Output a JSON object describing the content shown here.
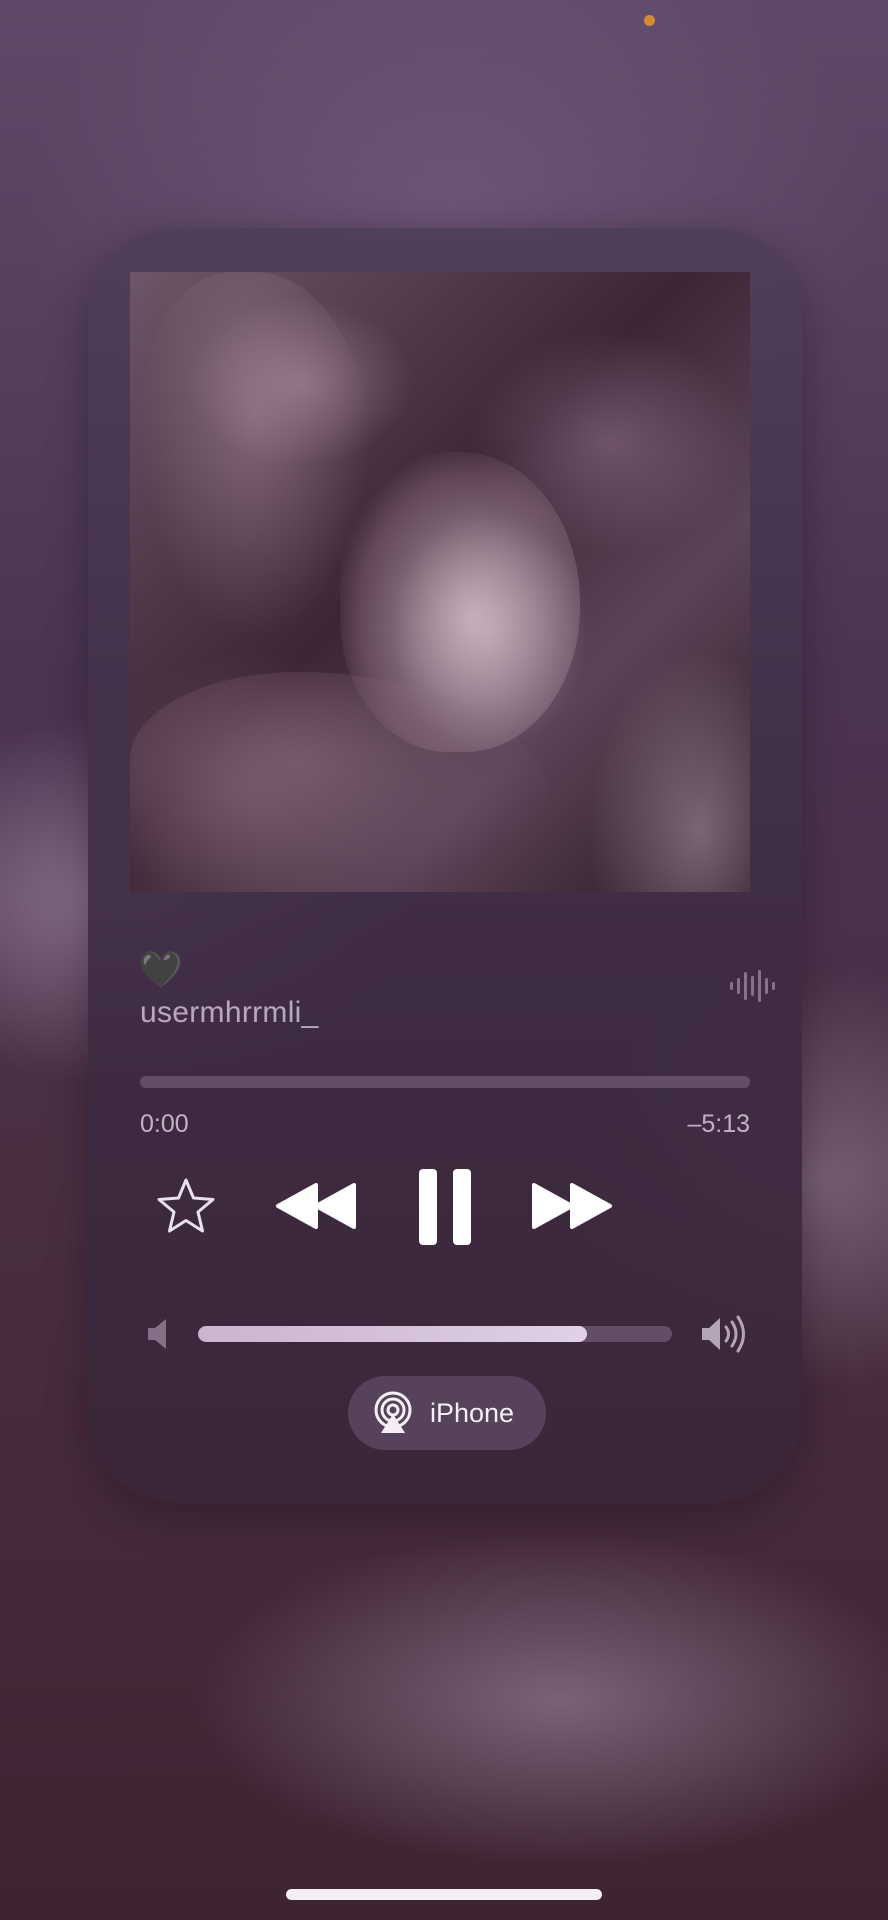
{
  "player": {
    "favorite_emoji": "🖤",
    "title": "usermhrrmli_",
    "progress": {
      "elapsed": "0:00",
      "remaining": "–5:13",
      "fraction": 0.0
    },
    "volume": {
      "level": 0.82
    },
    "output": {
      "label": "iPhone"
    }
  },
  "icons": {
    "wave": "waveform-icon",
    "favorite": "star-icon",
    "previous": "backward-icon",
    "playpause": "pause-icon",
    "next": "forward-icon",
    "volume_low": "speaker-low-icon",
    "volume_high": "speaker-high-icon",
    "airplay": "airplay-icon"
  },
  "colors": {
    "accent_dot": "#d9892e",
    "background": "#4b3452"
  }
}
